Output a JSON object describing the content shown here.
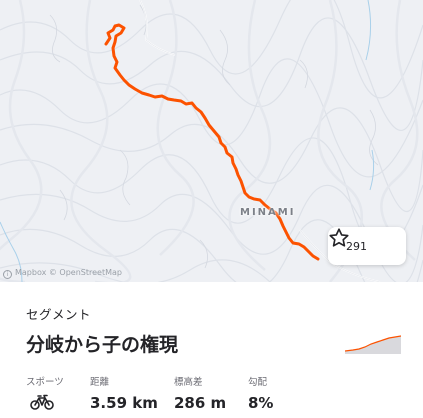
{
  "map": {
    "place_label": "MINAMI",
    "attribution": "Mapbox © OpenStreetMap",
    "route_color": "#fc5200"
  },
  "star": {
    "icon": "star-outline-icon",
    "count": "291"
  },
  "segment": {
    "section_label": "セグメント",
    "title": "分岐から子の権現",
    "elevation_profile_color": "#fc5200"
  },
  "stats": {
    "sport": {
      "label": "スポーツ",
      "icon": "bike-icon"
    },
    "distance": {
      "label": "距離",
      "value": "3.59 km"
    },
    "elevation": {
      "label": "標高差",
      "value": "286 m"
    },
    "grade": {
      "label": "勾配",
      "value": "8%"
    }
  }
}
